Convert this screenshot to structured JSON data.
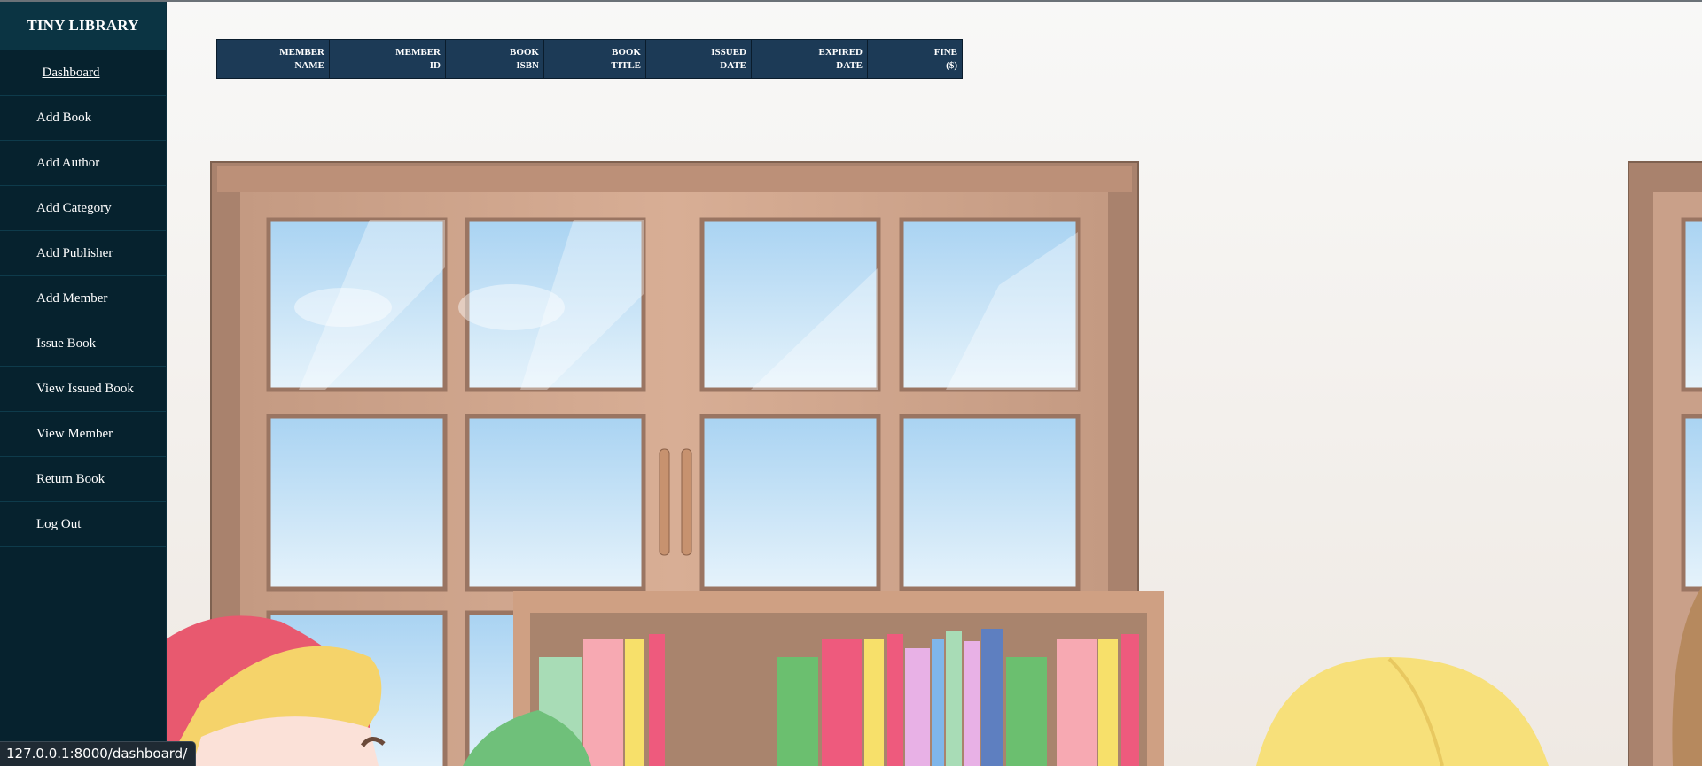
{
  "brand": "TINY LIBRARY",
  "nav": {
    "dashboard": "Dashboard",
    "items": [
      "Add Book",
      "Add Author",
      "Add Category",
      "Add Publisher",
      "Add Member",
      "Issue Book",
      "View Issued Book",
      "View Member",
      "Return Book",
      "Log Out"
    ]
  },
  "table": {
    "columns": [
      {
        "line1": "MEMBER",
        "line2": "NAME"
      },
      {
        "line1": "MEMBER",
        "line2": "ID"
      },
      {
        "line1": "BOOK",
        "line2": "ISBN"
      },
      {
        "line1": "BOOK",
        "line2": "TITLE"
      },
      {
        "line1": "ISSUED",
        "line2": "DATE"
      },
      {
        "line1": "EXPIRED",
        "line2": "DATE"
      },
      {
        "line1": "FINE",
        "line2": "($)"
      }
    ]
  },
  "status_url": "127.0.0.1:8000/dashboard/",
  "colors": {
    "sidebar": "#06222e",
    "brand_bg": "#0b3443",
    "table_header": "#1c3a56"
  }
}
